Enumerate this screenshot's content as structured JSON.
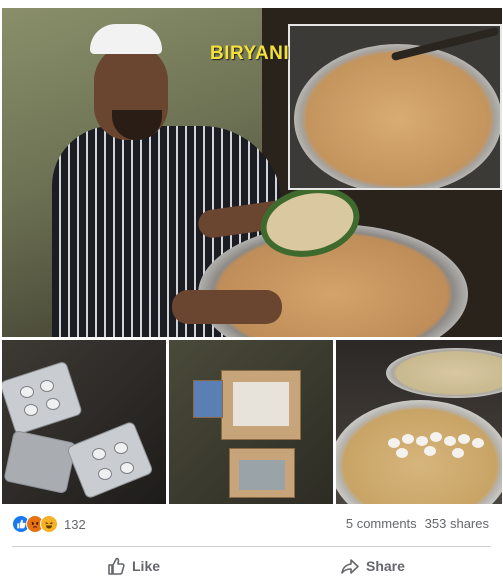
{
  "post": {
    "overlay_text": "BIRYANI"
  },
  "reactions": {
    "icons": [
      "like-icon",
      "angry-icon",
      "haha-icon"
    ],
    "count": "132"
  },
  "stats": {
    "comments": "5 comments",
    "shares": "353 shares"
  },
  "actions": {
    "like_label": "Like",
    "share_label": "Share"
  },
  "colors": {
    "like_blue": "#1877f2",
    "angry_orange": "#e9710f",
    "haha_yellow": "#f7b125",
    "secondary_text": "#65676b",
    "overlay_yellow": "#f4e03a"
  }
}
